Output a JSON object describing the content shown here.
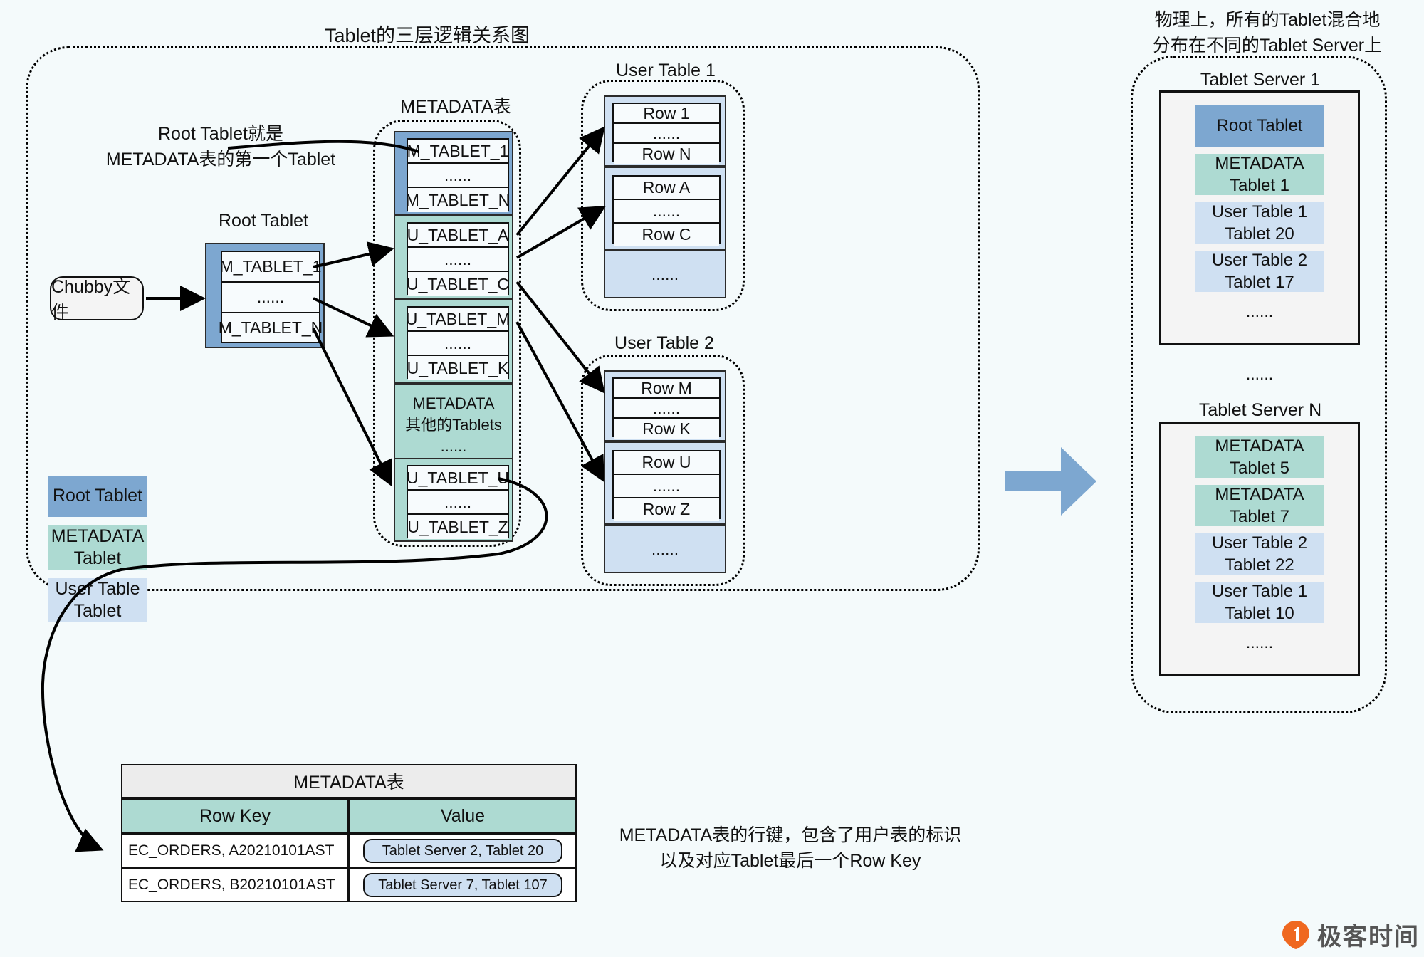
{
  "titles": {
    "left_diagram": "Tablet的三层逻辑关系图",
    "right_note_line1": "物理上，所有的Tablet混合地",
    "right_note_line2": "分布在不同的Tablet Server上",
    "metadata_table_label": "METADATA表",
    "root_tablet_label": "Root Tablet",
    "user_table_1": "User Table 1",
    "user_table_2": "User Table 2"
  },
  "annotations": {
    "root_tablet_note_line1": "Root Tablet就是",
    "root_tablet_note_line2": "METADATA表的第一个Tablet",
    "rowkey_note_line1": "METADATA表的行键，包含了用户表的标识",
    "rowkey_note_line2": "以及对应Tablet最后一个Row Key"
  },
  "chubby": {
    "label": "Chubby文件"
  },
  "root_tablet": {
    "rows": [
      "M_TABLET_1",
      "......",
      "M_TABLET_N"
    ]
  },
  "metadata_table": {
    "blocks": [
      {
        "kind": "root",
        "rows": [
          "M_TABLET_1",
          "......",
          "M_TABLET_N"
        ]
      },
      {
        "kind": "metadata",
        "rows": [
          "U_TABLET_A",
          "......",
          "U_TABLET_C"
        ]
      },
      {
        "kind": "metadata",
        "rows": [
          "U_TABLET_M",
          "......",
          "U_TABLET_K"
        ]
      },
      {
        "kind": "metadata-other",
        "lines": [
          "METADATA",
          "其他的Tablets",
          "......"
        ]
      },
      {
        "kind": "metadata",
        "rows": [
          "U_TABLET_U",
          "......",
          "U_TABLET_Z"
        ]
      }
    ]
  },
  "user_table_1": {
    "blocks": [
      {
        "rows": [
          "Row 1",
          "......",
          "Row N"
        ]
      },
      {
        "rows": [
          "Row A",
          "......",
          "Row C"
        ]
      }
    ],
    "ellipsis": "......"
  },
  "user_table_2": {
    "blocks": [
      {
        "rows": [
          "Row M",
          "......",
          "Row K"
        ]
      },
      {
        "rows": [
          "Row U",
          "......",
          "Row Z"
        ]
      }
    ],
    "ellipsis": "......"
  },
  "legend": {
    "items": [
      {
        "label": "Root Tablet",
        "color": "#7da7d0"
      },
      {
        "label": "METADATA\nTablet",
        "line1": "METADATA",
        "line2": "Tablet",
        "color": "#addad2"
      },
      {
        "label": "User Table\nTablet",
        "line1": "User Table",
        "line2": "Tablet",
        "color": "#cfe0f2"
      }
    ]
  },
  "servers": {
    "server1": {
      "title": "Tablet Server 1",
      "chips": [
        {
          "line1": "Root Tablet",
          "line2": "",
          "color": "#7da7d0"
        },
        {
          "line1": "METADATA",
          "line2": "Tablet 1",
          "color": "#addad2"
        },
        {
          "line1": "User Table 1",
          "line2": "Tablet 20",
          "color": "#cfe0f2"
        },
        {
          "line1": "User Table 2",
          "line2": "Tablet 17",
          "color": "#cfe0f2"
        }
      ],
      "ellipsis": "......"
    },
    "between_ellipsis": "......",
    "serverN": {
      "title": "Tablet Server N",
      "chips": [
        {
          "line1": "METADATA",
          "line2": "Tablet 5",
          "color": "#addad2"
        },
        {
          "line1": "METADATA",
          "line2": "Tablet 7",
          "color": "#addad2"
        },
        {
          "line1": "User Table 2",
          "line2": "Tablet 22",
          "color": "#cfe0f2"
        },
        {
          "line1": "User Table 1",
          "line2": "Tablet 10",
          "color": "#cfe0f2"
        }
      ],
      "ellipsis": "......"
    }
  },
  "metadata_detail_table": {
    "title": "METADATA表",
    "headers": [
      "Row Key",
      "Value"
    ],
    "rows": [
      {
        "row_key": "EC_ORDERS, A20210101AST",
        "value": "Tablet Server 2, Tablet 20"
      },
      {
        "row_key": "EC_ORDERS, B20210101AST",
        "value": "Tablet Server 7, Tablet 107"
      }
    ]
  },
  "logo": {
    "text": "极客时间"
  },
  "colors": {
    "root": "#7da7d0",
    "metadata": "#addad2",
    "user": "#cfe0f2",
    "background": "#f4fafb",
    "arrow": "#7da7d0"
  }
}
